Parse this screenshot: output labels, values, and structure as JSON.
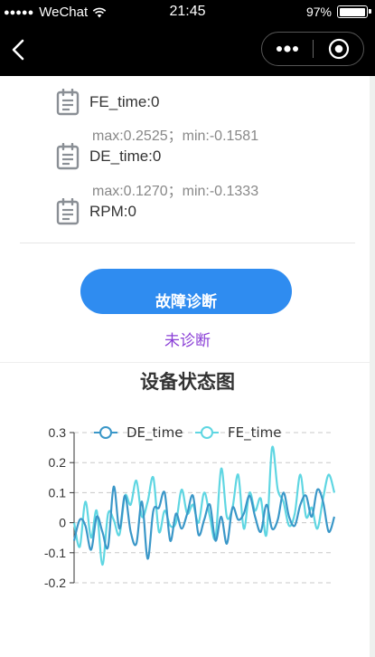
{
  "status_bar": {
    "signal_dots": "●●●●●",
    "carrier": "WeChat",
    "time": "21:45",
    "battery": "97%",
    "battery_level": 0.97
  },
  "nav": {
    "back_icon": "chevron-left-icon",
    "more_icon": "more-dots-icon",
    "close_icon": "target-circle-icon"
  },
  "params": [
    {
      "label": "FE_time:0",
      "range": "max:0.2525；min:-0.1581"
    },
    {
      "label": "DE_time:0",
      "range": "max:0.1270；min:-0.1333"
    },
    {
      "label": "RPM:0"
    }
  ],
  "diagnose_button": "故障诊断",
  "diagnose_status": "未诊断",
  "chart_title": "设备状态图",
  "colors": {
    "button": "#2f8cf0",
    "status_text": "#8a3fd6",
    "de_series": "#3a97c8",
    "fe_series": "#5fd6e2"
  },
  "chart_data": {
    "type": "line",
    "ylim": [
      -0.2,
      0.3
    ],
    "yticks": [
      "0.3",
      "0.2",
      "0.1",
      "0",
      "-0.1",
      "-0.2"
    ],
    "legend_position": "top",
    "grid": "dashed horizontal",
    "series": [
      {
        "name": "DE_time",
        "values": [
          -0.06,
          0.01,
          -0.01,
          -0.09,
          0.02,
          -0.03,
          -0.08,
          0.12,
          -0.02,
          0.09,
          -0.03,
          -0.07,
          0.07,
          -0.12,
          0.04,
          0.05,
          0.1,
          -0.06,
          0.03,
          -0.02,
          0.03,
          0.09,
          -0.04,
          0.01,
          0.06,
          -0.06,
          0.02,
          -0.07,
          0.05,
          0.01,
          0.03,
          0.09,
          0.02,
          -0.03,
          0.06,
          -0.02,
          0.01,
          0.1,
          0.02,
          -0.01,
          0.06,
          0.09,
          0.02,
          0.11,
          0.07,
          -0.03,
          0.02
        ]
      },
      {
        "name": "FE_time",
        "values": [
          0.0,
          -0.08,
          0.07,
          -0.05,
          0.04,
          -0.14,
          0.03,
          0.01,
          -0.04,
          0.09,
          0.06,
          0.14,
          0.02,
          0.07,
          0.15,
          -0.03,
          0.04,
          -0.01,
          0.0,
          0.11,
          0.03,
          0.06,
          0.0,
          0.1,
          0.02,
          -0.05,
          0.18,
          0.02,
          0.05,
          0.16,
          -0.02,
          0.1,
          0.04,
          0.08,
          -0.04,
          0.25,
          0.11,
          0.07,
          -0.01,
          0.03,
          0.16,
          0.02,
          0.05,
          -0.02,
          0.08,
          0.16,
          0.1
        ]
      }
    ]
  }
}
